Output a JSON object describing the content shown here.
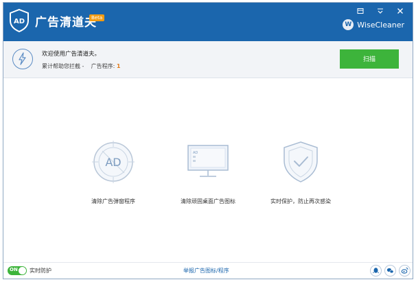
{
  "title_bar": {
    "app_title": "广告清道夫",
    "beta_label": "Beta",
    "logo_text": "AD",
    "brand_badge": "W",
    "brand_name": "WiseCleaner"
  },
  "window_controls": {
    "menu_icon": "menu-icon",
    "minimize_icon": "minimize-icon",
    "close_icon": "close-icon"
  },
  "welcome": {
    "message": "欢迎使用广告清道夫。",
    "stats_prefix": "累计帮助您拦截 -",
    "program_label": "广告程序:",
    "program_count": "1",
    "scan_button": "扫描"
  },
  "features": [
    {
      "icon": "ad-block-icon",
      "icon_text": "AD",
      "label": "清除广告弹窗程序"
    },
    {
      "icon": "monitor-icon",
      "icon_text": "AD",
      "label": "清除顽固桌面广告图标"
    },
    {
      "icon": "shield-check-icon",
      "label": "实时保护，防止再次感染"
    }
  ],
  "footer": {
    "toggle_state": "ON",
    "realtime_label": "实时防护",
    "report_link": "举报广告图标/程序",
    "social": [
      {
        "icon": "qq-icon"
      },
      {
        "icon": "wechat-icon"
      },
      {
        "icon": "weibo-icon"
      }
    ]
  },
  "colors": {
    "title_bar": "#1b66ad",
    "scan_button": "#3db43b",
    "toggle_on": "#3db43b",
    "accent_count": "#e27b1b",
    "beta_badge": "#f39c12"
  }
}
